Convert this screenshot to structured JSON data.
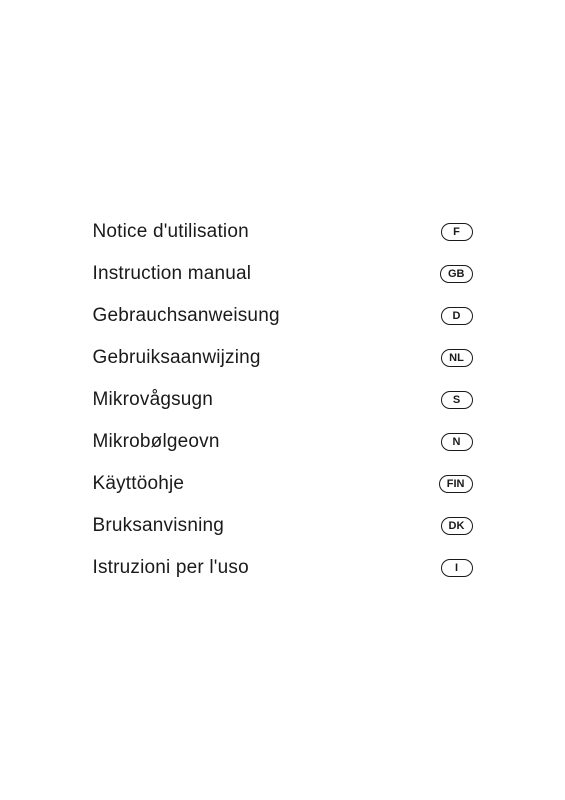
{
  "rows": [
    {
      "label": "Notice d'utilisation",
      "badge": "F"
    },
    {
      "label": "Instruction manual",
      "badge": "GB"
    },
    {
      "label": "Gebrauchsanweisung",
      "badge": "D"
    },
    {
      "label": "Gebruiksaanwijzing",
      "badge": "NL"
    },
    {
      "label": "Mikrovågsugn",
      "badge": "S"
    },
    {
      "label": "Mikrobølgeovn",
      "badge": "N"
    },
    {
      "label": "Käyttöohje",
      "badge": "FIN"
    },
    {
      "label": "Bruksanvisning",
      "badge": "DK"
    },
    {
      "label": "Istruzioni per l'uso",
      "badge": "I"
    }
  ]
}
